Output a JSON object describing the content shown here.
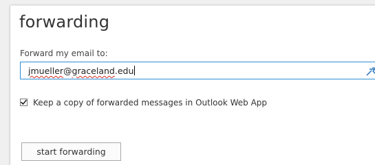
{
  "page": {
    "title": "forwarding"
  },
  "form": {
    "forward_label": "Forward my email to:",
    "email_user": "jmueller",
    "email_at": "@",
    "email_domain_spell": "graceland",
    "email_tld": ".edu",
    "keep_copy_checked": true,
    "keep_copy_label": "Keep a copy of forwarded messages in Outlook Web App",
    "start_button_label": "start forwarding"
  },
  "icons": {
    "autocomplete": "pushpin-arrow-icon",
    "checkmark": "check-icon"
  },
  "colors": {
    "input_border": "#2a8dd4",
    "spell_underline": "#d52b1e",
    "icon_blue": "#1e6fb8"
  }
}
